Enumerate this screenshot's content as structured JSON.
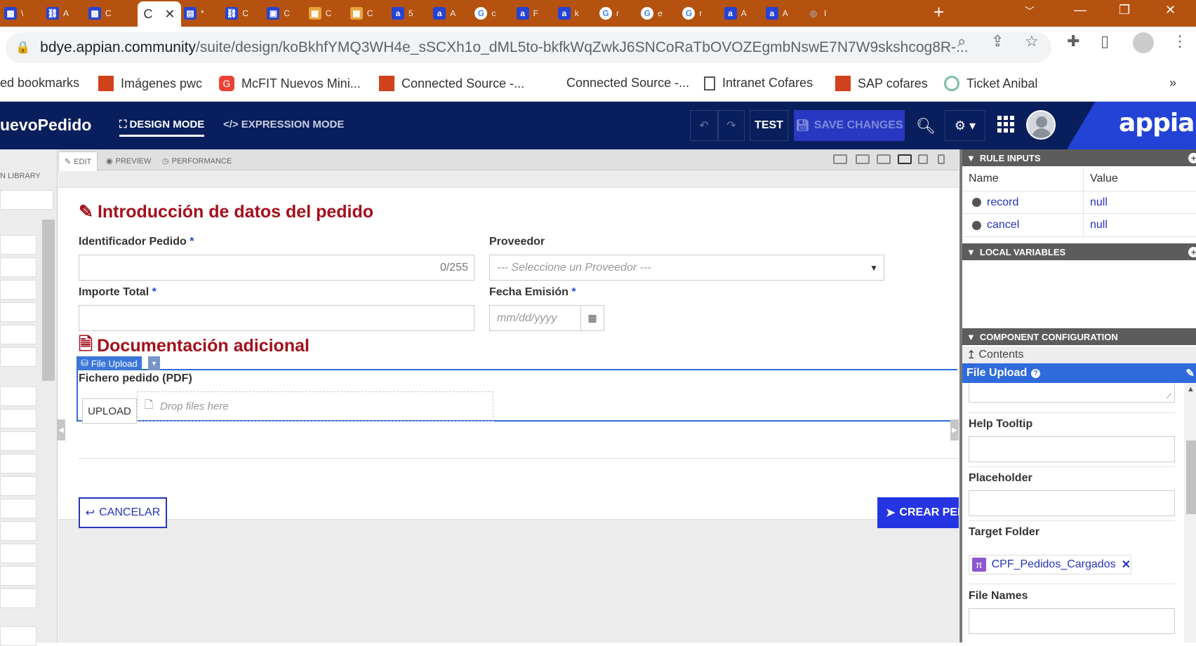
{
  "browser": {
    "tabs": [
      {
        "icon": "grid-icon",
        "text": "\\",
        "color": "#2743d3"
      },
      {
        "icon": "flow-icon",
        "text": "A",
        "color": "#2743d3"
      },
      {
        "icon": "grid-icon",
        "text": "C",
        "color": "#2743d3"
      },
      {
        "icon": "form-icon",
        "text": "*",
        "color": "#2743d3"
      },
      {
        "icon": "flow-icon",
        "text": "C",
        "color": "#2743d3"
      },
      {
        "icon": "calendar-icon",
        "text": "C",
        "color": "#2743d3"
      },
      {
        "icon": "table-icon",
        "text": "C",
        "color": "#e8a33b"
      },
      {
        "icon": "table-icon",
        "text": "C",
        "color": "#e8a33b"
      },
      {
        "icon": "appian-icon",
        "text": "5",
        "color": "#2743d3"
      },
      {
        "icon": "appian-icon",
        "text": "A",
        "color": "#2743d3"
      },
      {
        "icon": "google-icon",
        "text": "c",
        "color": "#ffffff"
      },
      {
        "icon": "appian-icon",
        "text": "F",
        "color": "#2743d3"
      },
      {
        "icon": "appian-icon",
        "text": "k",
        "color": "#2743d3"
      },
      {
        "icon": "google-icon",
        "text": "r",
        "color": "#ffffff"
      },
      {
        "icon": "google-icon",
        "text": "e",
        "color": "#ffffff"
      },
      {
        "icon": "google-icon",
        "text": "r",
        "color": "#ffffff"
      },
      {
        "icon": "appian-icon",
        "text": "A",
        "color": "#2743d3"
      },
      {
        "icon": "appian-icon",
        "text": "A",
        "color": "#2743d3"
      },
      {
        "icon": "globe-icon",
        "text": "I",
        "color": "#888888"
      }
    ],
    "active_tab_text": "C",
    "address": {
      "domain": "bdye.appian.community",
      "path": "/suite/design/koBkhfYMQ3WH4e_sSCXh1o_dML5to-bkfkWqZwkJ6SNCoRaTbOVOZEgmbNswE7N7W9skshcog8R-..."
    },
    "bookmarks": [
      {
        "label": "ed bookmarks",
        "icon": "none"
      },
      {
        "label": "Imágenes pwc",
        "icon": "pwc-icon"
      },
      {
        "label": "McFIT Nuevos Mini...",
        "icon": "g-suite-icon"
      },
      {
        "label": "Connected Source -...",
        "icon": "pwc-icon"
      },
      {
        "label": "Connected Source -...",
        "icon": "none"
      },
      {
        "label": "Intranet Cofares",
        "icon": "doc-icon"
      },
      {
        "label": "SAP cofares",
        "icon": "pwc-icon"
      },
      {
        "label": "Ticket Anibal",
        "icon": "ticket-icon"
      }
    ]
  },
  "app": {
    "title": "uevoPedido",
    "design_mode": "DESIGN MODE",
    "expression_mode": "EXPRESSION MODE",
    "test_label": "TEST",
    "save_label": "SAVE CHANGES",
    "logo": "appian",
    "accent": "#2343d6",
    "header_bg": "#091e5c"
  },
  "left_panel": {
    "library_label": "N LIBRARY"
  },
  "canvas": {
    "tabs": [
      "EDIT",
      "PREVIEW",
      "PERFORMANCE"
    ],
    "section1": "Introducción de datos del pedido",
    "section2": "Documentación adicional",
    "fields": {
      "identificador_label": "Identificador Pedido",
      "identificador_counter": "0/255",
      "proveedor_label": "Proveedor",
      "proveedor_placeholder": "--- Seleccione un Proveedor ---",
      "importe_label": "Importe Total",
      "fecha_label": "Fecha Emisión",
      "fecha_placeholder": "mm/dd/yyyy",
      "required_marker": "*"
    },
    "file_upload": {
      "tag": "File Upload",
      "label": "Fichero pedido (PDF)",
      "upload_button": "UPLOAD",
      "drop_text": "Drop files here"
    },
    "cancel_button": "CANCELAR",
    "create_button": "CREAR PED"
  },
  "right_panel": {
    "rule_inputs_title": "RULE INPUTS",
    "col_name": "Name",
    "col_value": "Value",
    "rule_inputs": [
      {
        "name": "record",
        "value": "null"
      },
      {
        "name": "cancel",
        "value": "null"
      }
    ],
    "local_variables_title": "LOCAL VARIABLES",
    "component_config_title": "COMPONENT CONFIGURATION",
    "contents_label": "Contents",
    "selected_component": "File Upload",
    "help_tooltip_label": "Help Tooltip",
    "placeholder_label": "Placeholder",
    "target_folder_label": "Target Folder",
    "target_folder_value": "CPF_Pedidos_Cargados",
    "file_names_label": "File Names"
  }
}
